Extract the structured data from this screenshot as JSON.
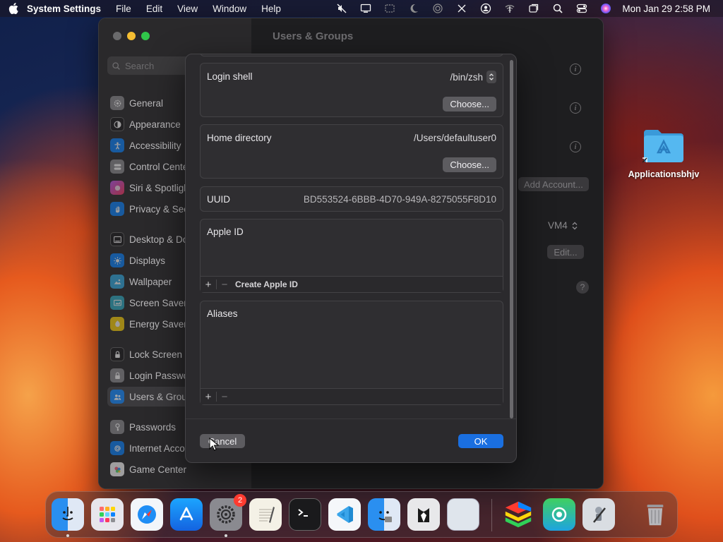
{
  "menubar": {
    "app_name": "System Settings",
    "menus": [
      "File",
      "Edit",
      "View",
      "Window",
      "Help"
    ],
    "clock": "Mon Jan 29  2:58 PM",
    "status_icons": [
      "mute-icon",
      "display-icon",
      "screen-mirror-icon",
      "focus-moon-icon",
      "fingerprint-icon",
      "pen-icon",
      "user-circle-icon",
      "wifi-icon",
      "window-icon",
      "search-icon",
      "control-center-icon",
      "siri-icon"
    ]
  },
  "window": {
    "title": "Users & Groups",
    "search_placeholder": "Search",
    "sidebar": [
      {
        "label": "General",
        "icon": "gear-icon",
        "color": "#8e8e93"
      },
      {
        "label": "Appearance",
        "icon": "appearance-icon",
        "color": "#1c1c1e"
      },
      {
        "label": "Accessibility",
        "icon": "accessibility-icon",
        "color": "#0a84ff"
      },
      {
        "label": "Control Center",
        "icon": "control-center-icon",
        "color": "#8e8e93"
      },
      {
        "label": "Siri & Spotlight",
        "icon": "siri-icon",
        "color": "#bf5af2"
      },
      {
        "label": "Privacy & Security",
        "icon": "hand-icon",
        "color": "#0a84ff"
      },
      {
        "label": "Desktop & Dock",
        "icon": "dock-icon",
        "color": "#1c1c1e"
      },
      {
        "label": "Displays",
        "icon": "sun-icon",
        "color": "#0a84ff"
      },
      {
        "label": "Wallpaper",
        "icon": "wallpaper-icon",
        "color": "#32ade6"
      },
      {
        "label": "Screen Saver",
        "icon": "screensaver-icon",
        "color": "#30b0c7"
      },
      {
        "label": "Energy Saver",
        "icon": "battery-icon",
        "color": "#ffd60a"
      },
      {
        "label": "Lock Screen",
        "icon": "lock-icon",
        "color": "#1c1c1e"
      },
      {
        "label": "Login Password",
        "icon": "password-icon",
        "color": "#8e8e93"
      },
      {
        "label": "Users & Groups",
        "icon": "users-icon",
        "color": "#0a84ff"
      },
      {
        "label": "Passwords",
        "icon": "key-icon",
        "color": "#8e8e93"
      },
      {
        "label": "Internet Accounts",
        "icon": "at-icon",
        "color": "#0a84ff"
      },
      {
        "label": "Game Center",
        "icon": "game-center-icon",
        "color": "#ffffff"
      }
    ],
    "add_account_label": "Add Account...",
    "vm_select_value": "VM4",
    "edit_label": "Edit...",
    "help_label": "?"
  },
  "sheet": {
    "login_shell": {
      "label": "Login shell",
      "value": "/bin/zsh",
      "choose_label": "Choose..."
    },
    "home_directory": {
      "label": "Home directory",
      "value": "/Users/defaultuser0",
      "choose_label": "Choose..."
    },
    "uuid": {
      "label": "UUID",
      "value": "BD553524-6BBB-4D70-949A-8275055F8D10"
    },
    "apple_id": {
      "label": "Apple ID",
      "add_label": "+",
      "remove_label": "−",
      "create_label": "Create Apple ID"
    },
    "aliases": {
      "label": "Aliases",
      "add_label": "+",
      "remove_label": "−"
    },
    "cancel_label": "Cancel",
    "ok_label": "OK"
  },
  "desktop": {
    "folder_label": "Applicationsbhjv"
  },
  "dock": {
    "apps": [
      {
        "name": "finder",
        "icon": "finder-icon",
        "running": true
      },
      {
        "name": "launchpad",
        "icon": "launchpad-icon",
        "running": false
      },
      {
        "name": "safari",
        "icon": "safari-icon",
        "running": false
      },
      {
        "name": "app-store",
        "icon": "app-store-icon",
        "running": false
      },
      {
        "name": "system-settings",
        "icon": "system-settings-icon",
        "running": true,
        "badge": "2"
      },
      {
        "name": "textedit",
        "icon": "textedit-icon",
        "running": false
      },
      {
        "name": "terminal",
        "icon": "terminal-icon",
        "running": false
      },
      {
        "name": "vscode",
        "icon": "vscode-icon",
        "running": false
      },
      {
        "name": "migration-assistant",
        "icon": "migration-icon",
        "running": false
      },
      {
        "name": "bartender",
        "icon": "tuxedo-icon",
        "running": false
      },
      {
        "name": "preview",
        "icon": "blank-app-icon",
        "running": false
      },
      {
        "name": "bluestacks",
        "icon": "bluestacks-icon",
        "running": false
      },
      {
        "name": "find-my",
        "icon": "find-my-icon",
        "running": false
      },
      {
        "name": "automator",
        "icon": "automator-icon",
        "running": false
      },
      {
        "name": "trash",
        "icon": "trash-icon",
        "running": false
      }
    ]
  }
}
